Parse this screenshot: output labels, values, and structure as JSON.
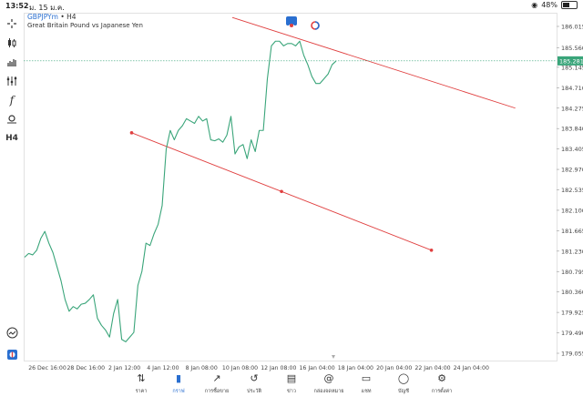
{
  "status": {
    "time": "13:52",
    "date": "ม. 15 ม.ค.",
    "battery": "48%"
  },
  "symbol": {
    "name": "GBPJPYm",
    "sep": " • ",
    "timeframe": "H4",
    "description": "Great Britain Pound vs Japanese Yen"
  },
  "toolbar": {
    "timeframe_label": "H4",
    "function_label": "f"
  },
  "chart_data": {
    "type": "line",
    "y_ticks": [
      "186.015",
      "185.560",
      "185.145",
      "184.710",
      "184.275",
      "183.840",
      "183.405",
      "182.970",
      "182.535",
      "182.100",
      "181.665",
      "181.230",
      "180.795",
      "180.360",
      "179.925",
      "179.490",
      "179.055"
    ],
    "x_ticks": [
      "26 Dec 16:00",
      "28 Dec 16:00",
      "2 Jan 12:00",
      "4 Jan 12:00",
      "8 Jan 08:00",
      "10 Jan 08:00",
      "12 Jan 08:00",
      "16 Jan 04:00",
      "18 Jan 04:00",
      "20 Jan 04:00",
      "22 Jan 04:00",
      "24 Jan 04:00"
    ],
    "current_price": "185.281",
    "line_color": "#3aa57a",
    "trendline_color": "#e04040",
    "price_series": [
      181.1,
      181.18,
      181.15,
      181.25,
      181.5,
      181.65,
      181.4,
      181.2,
      180.9,
      180.6,
      180.2,
      179.95,
      180.05,
      180.0,
      180.1,
      180.12,
      180.2,
      180.3,
      179.8,
      179.65,
      179.55,
      179.4,
      179.9,
      180.2,
      179.35,
      179.3,
      179.4,
      179.5,
      180.5,
      180.8,
      181.4,
      181.35,
      181.6,
      181.8,
      182.2,
      183.4,
      183.8,
      183.6,
      183.8,
      183.9,
      184.05,
      184.0,
      183.95,
      184.1,
      184.0,
      184.05,
      183.6,
      183.58,
      183.62,
      183.55,
      183.7,
      184.1,
      183.3,
      183.45,
      183.5,
      183.2,
      183.6,
      183.35,
      183.8,
      183.8,
      184.9,
      185.6,
      185.7,
      185.7,
      185.6,
      185.65,
      185.65,
      185.6,
      185.7,
      185.4,
      185.2,
      184.95,
      184.8,
      184.8,
      184.9,
      185.0,
      185.2,
      185.28
    ],
    "trendlines": [
      {
        "p1": [
          0.373,
          186.205
        ],
        "p2": [
          0.879,
          184.275
        ]
      },
      {
        "p1": [
          0.193,
          183.75
        ],
        "p2": [
          0.729,
          181.25
        ]
      }
    ]
  },
  "nav": [
    {
      "label": "ราคา",
      "icon": "quotes-icon"
    },
    {
      "label": "กราฟ",
      "icon": "chart-icon",
      "active": true
    },
    {
      "label": "การซื้อขาย",
      "icon": "trade-icon"
    },
    {
      "label": "ประวัติ",
      "icon": "history-icon"
    },
    {
      "label": "ข่าว",
      "icon": "news-icon"
    },
    {
      "label": "กล่องจดหมาย",
      "icon": "mailbox-icon"
    },
    {
      "label": "แชท",
      "icon": "chat-icon"
    },
    {
      "label": "บัญชี",
      "icon": "account-icon"
    },
    {
      "label": "การตั้งค่า",
      "icon": "settings-icon"
    }
  ]
}
